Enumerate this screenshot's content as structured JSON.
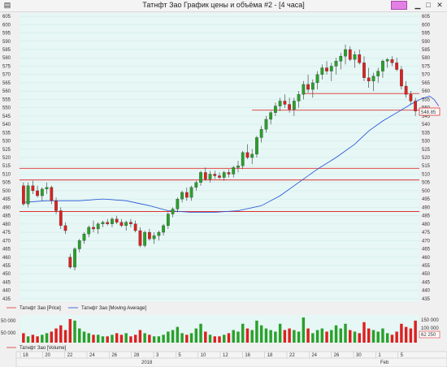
{
  "window": {
    "title": "Татнфт Зао График цены и объёма #2 - [4 часа]",
    "buttons": {
      "minimize": "▁",
      "maximize": "□",
      "close": "✕"
    }
  },
  "price_panel": {
    "y_ticks": [
      605,
      600,
      595,
      590,
      585,
      580,
      575,
      570,
      565,
      560,
      555,
      550,
      545,
      540,
      535,
      530,
      525,
      520,
      515,
      510,
      505,
      500,
      495,
      490,
      485,
      480,
      475,
      470,
      465,
      460,
      455,
      450,
      445,
      440,
      435
    ],
    "last_price_label": "548.85",
    "horizontal_levels": [
      {
        "price": 513.5,
        "color": "#e03030"
      },
      {
        "price": 506.5,
        "color": "#e03030"
      },
      {
        "price": 487.5,
        "color": "#e03030"
      },
      {
        "price": 558.5,
        "color": "#e03030"
      },
      {
        "price": 548.5,
        "color": "#e03030"
      }
    ]
  },
  "legend": {
    "price": "Татнфт Зао [Price]",
    "ma": "Татнфт Зао [Moving Average]",
    "volume": "Татнфт Зао [Volume]"
  },
  "volume_panel": {
    "left_ticks": [
      "50 000",
      "50 000"
    ],
    "right_ticks": [
      "150 000",
      "100 000"
    ],
    "last_label": "62 250"
  },
  "date_axis": {
    "days": [
      "18",
      "20",
      "22",
      "24",
      "26",
      "28",
      "3",
      "5",
      "10",
      "12",
      "16",
      "18",
      "22",
      "24",
      "26",
      "30",
      "1",
      "5"
    ],
    "year_label": "2018",
    "month_label": "Feb"
  },
  "colors": {
    "up": "#2aa02a",
    "down": "#dd2020",
    "ma": "#1f4ed8",
    "grid": "#cfe9e6",
    "bg": "#e6f7f5"
  },
  "chart_data": {
    "type": "candlestick",
    "title": "Татнфт Зао График цены и объёма #2 - [4 часа]",
    "ylim": [
      433,
      607
    ],
    "candles": [
      [
        503,
        505,
        491,
        492
      ],
      [
        492,
        505,
        490,
        503
      ],
      [
        503,
        506,
        498,
        500
      ],
      [
        500,
        503,
        496,
        497
      ],
      [
        497,
        502,
        494,
        501
      ],
      [
        501,
        505,
        498,
        502
      ],
      [
        502,
        503,
        492,
        494
      ],
      [
        494,
        496,
        486,
        488
      ],
      [
        488,
        490,
        477,
        479
      ],
      [
        479,
        481,
        474,
        476
      ],
      [
        460,
        462,
        453,
        454
      ],
      [
        454,
        466,
        452,
        465
      ],
      [
        465,
        471,
        463,
        470
      ],
      [
        470,
        475,
        468,
        474
      ],
      [
        474,
        479,
        472,
        478
      ],
      [
        478,
        482,
        475,
        477
      ],
      [
        477,
        481,
        474,
        480
      ],
      [
        480,
        482,
        478,
        481
      ],
      [
        481,
        483,
        479,
        480
      ],
      [
        480,
        484,
        478,
        483
      ],
      [
        483,
        485,
        480,
        481
      ],
      [
        481,
        483,
        478,
        479
      ],
      [
        479,
        482,
        476,
        481
      ],
      [
        481,
        483,
        478,
        480
      ],
      [
        480,
        482,
        475,
        476
      ],
      [
        476,
        478,
        466,
        467
      ],
      [
        467,
        476,
        466,
        475
      ],
      [
        475,
        477,
        470,
        471
      ],
      [
        471,
        475,
        468,
        473
      ],
      [
        473,
        476,
        470,
        475
      ],
      [
        475,
        480,
        473,
        479
      ],
      [
        479,
        487,
        477,
        486
      ],
      [
        486,
        490,
        484,
        489
      ],
      [
        489,
        496,
        487,
        495
      ],
      [
        495,
        500,
        493,
        499
      ],
      [
        499,
        502,
        494,
        496
      ],
      [
        496,
        503,
        494,
        502
      ],
      [
        502,
        506,
        500,
        505
      ],
      [
        505,
        512,
        503,
        511
      ],
      [
        511,
        514,
        506,
        507
      ],
      [
        507,
        512,
        505,
        510
      ],
      [
        510,
        512,
        507,
        509
      ],
      [
        509,
        511,
        507,
        508
      ],
      [
        508,
        512,
        506,
        511
      ],
      [
        511,
        513,
        508,
        510
      ],
      [
        510,
        515,
        508,
        514
      ],
      [
        514,
        518,
        511,
        515
      ],
      [
        515,
        524,
        513,
        523
      ],
      [
        523,
        528,
        519,
        520
      ],
      [
        520,
        525,
        516,
        522
      ],
      [
        522,
        533,
        520,
        532
      ],
      [
        532,
        539,
        529,
        537
      ],
      [
        537,
        545,
        535,
        543
      ],
      [
        543,
        548,
        540,
        547
      ],
      [
        547,
        553,
        545,
        551
      ],
      [
        551,
        556,
        548,
        554
      ],
      [
        554,
        558,
        550,
        552
      ],
      [
        552,
        556,
        547,
        549
      ],
      [
        549,
        556,
        545,
        554
      ],
      [
        554,
        560,
        550,
        558
      ],
      [
        558,
        566,
        555,
        564
      ],
      [
        564,
        570,
        559,
        561
      ],
      [
        561,
        567,
        556,
        565
      ],
      [
        565,
        572,
        561,
        570
      ],
      [
        570,
        576,
        567,
        574
      ],
      [
        574,
        578,
        570,
        572
      ],
      [
        572,
        577,
        566,
        575
      ],
      [
        575,
        580,
        570,
        578
      ],
      [
        578,
        583,
        573,
        581
      ],
      [
        581,
        588,
        576,
        585
      ],
      [
        585,
        587,
        578,
        579
      ],
      [
        579,
        584,
        574,
        582
      ],
      [
        582,
        585,
        576,
        577
      ],
      [
        577,
        581,
        566,
        568
      ],
      [
        568,
        574,
        562,
        566
      ],
      [
        566,
        571,
        560,
        569
      ],
      [
        569,
        574,
        565,
        572
      ],
      [
        572,
        579,
        568,
        578
      ],
      [
        578,
        580,
        574,
        579
      ],
      [
        579,
        581,
        575,
        577
      ],
      [
        577,
        580,
        572,
        573
      ],
      [
        573,
        575,
        561,
        563
      ],
      [
        563,
        566,
        556,
        558
      ],
      [
        558,
        560,
        552,
        554
      ],
      [
        554,
        556,
        545,
        548
      ]
    ],
    "moving_average": [
      [
        0,
        493
      ],
      [
        5,
        494
      ],
      [
        12,
        494
      ],
      [
        17,
        495
      ],
      [
        22,
        494
      ],
      [
        27,
        491
      ],
      [
        31,
        488
      ],
      [
        36,
        487
      ],
      [
        41,
        487
      ],
      [
        46,
        488
      ],
      [
        51,
        491
      ],
      [
        55,
        497
      ],
      [
        59,
        505
      ],
      [
        63,
        513
      ],
      [
        67,
        520
      ],
      [
        71,
        528
      ],
      [
        74,
        536
      ],
      [
        77,
        542
      ],
      [
        80,
        547
      ],
      [
        83,
        552
      ],
      [
        85,
        555
      ],
      [
        87,
        557
      ],
      [
        88,
        555
      ],
      [
        89,
        551
      ]
    ],
    "volume": [
      6,
      4,
      5,
      4,
      5,
      6,
      7,
      9,
      11,
      8,
      15,
      14,
      9,
      7,
      6,
      5,
      5,
      4,
      4,
      5,
      6,
      5,
      6,
      4,
      5,
      8,
      6,
      5,
      4,
      4,
      5,
      7,
      8,
      10,
      6,
      5,
      6,
      9,
      12,
      7,
      5,
      4,
      4,
      5,
      6,
      8,
      7,
      12,
      9,
      8,
      14,
      11,
      9,
      8,
      7,
      12,
      8,
      9,
      8,
      7,
      16,
      9,
      6,
      8,
      9,
      7,
      8,
      11,
      9,
      12,
      8,
      7,
      6,
      13,
      9,
      8,
      7,
      9,
      6,
      5,
      7,
      12,
      10,
      9,
      14
    ]
  }
}
